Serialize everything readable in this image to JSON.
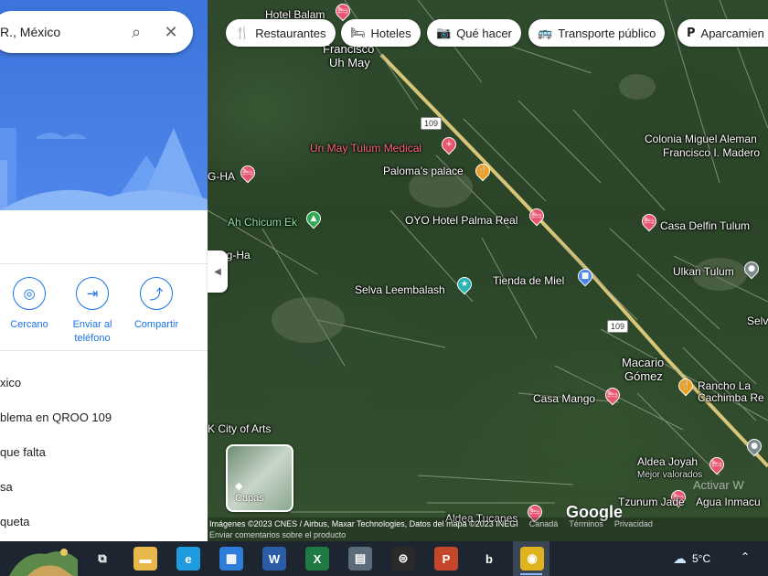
{
  "search": {
    "query": "R., México",
    "search_icon": "search-icon",
    "close_icon": "close-icon"
  },
  "chips": [
    {
      "label": "Restaurantes",
      "icon": "fork-knife-icon",
      "glyph": "🍴"
    },
    {
      "label": "Hoteles",
      "icon": "bed-icon",
      "glyph": "🛏"
    },
    {
      "label": "Qué hacer",
      "icon": "camera-icon",
      "glyph": "📷"
    },
    {
      "label": "Transporte público",
      "icon": "bus-icon",
      "glyph": "🚌"
    },
    {
      "label": "Aparcamien",
      "icon": "parking-icon",
      "glyph": "P"
    }
  ],
  "actions": [
    {
      "label": "Cercano",
      "icon": "nearby-icon",
      "glyph": "◎"
    },
    {
      "label": "Enviar al teléfono",
      "icon": "send-to-phone-icon",
      "glyph": "⇥"
    },
    {
      "label": "Compartir",
      "icon": "share-icon",
      "glyph": "⤴"
    }
  ],
  "list_items": [
    "xico",
    "blema en QROO 109",
    "que falta",
    "sa",
    "queta"
  ],
  "map": {
    "labels": [
      {
        "text": "Hotel Balam",
        "cls": ""
      },
      {
        "text": "Francisco",
        "cls": "big"
      },
      {
        "text": "Uh May",
        "cls": "big"
      },
      {
        "text": "Un May Tulum Medical",
        "cls": "pink"
      },
      {
        "text": "Paloma's palace",
        "cls": ""
      },
      {
        "text": "Colonia Miguel Aleman",
        "cls": ""
      },
      {
        "text": "Francisco I. Madero",
        "cls": ""
      },
      {
        "text": "G-HA",
        "cls": ""
      },
      {
        "text": "Ah Chicum Ek",
        "cls": "green"
      },
      {
        "text": "OYO Hotel Palma Real",
        "cls": ""
      },
      {
        "text": "Casa Delfin Tulum",
        "cls": ""
      },
      {
        "text": "ag-Ha",
        "cls": ""
      },
      {
        "text": "Ulkan Tulum",
        "cls": ""
      },
      {
        "text": "Selva Leembalash",
        "cls": ""
      },
      {
        "text": "Tienda de Miel",
        "cls": ""
      },
      {
        "text": "Selv",
        "cls": ""
      },
      {
        "text": "Macario",
        "cls": "big"
      },
      {
        "text": "Gómez",
        "cls": "big"
      },
      {
        "text": "Rancho La",
        "cls": ""
      },
      {
        "text": "Cachimba Re",
        "cls": ""
      },
      {
        "text": "Casa Mango",
        "cls": ""
      },
      {
        "text": "K City of Arts",
        "cls": ""
      },
      {
        "text": "Aldea Joyah",
        "cls": ""
      },
      {
        "text": "Mejor valorados",
        "cls": "small"
      },
      {
        "text": "Tzunum Jade",
        "cls": ""
      },
      {
        "text": "Agua Inmacu",
        "cls": ""
      },
      {
        "text": "Aldea Tucanes",
        "cls": ""
      }
    ],
    "road_shields": [
      "109",
      "109"
    ],
    "layers_label": "Capas",
    "attribution": "Imágenes ©2023 CNES / Airbus, Maxar Technologies, Datos del mapa ©2023 INEGI",
    "attribution_links": [
      "Canadá",
      "Términos",
      "Privacidad"
    ],
    "feedback": "Enviar comentarios sobre el producto",
    "logo": "Google",
    "watermark": "Activar W"
  },
  "taskbar": {
    "apps": [
      {
        "name": "task-view-icon",
        "glyph": "⧉",
        "color": "#1c2530"
      },
      {
        "name": "file-explorer-icon",
        "glyph": "▬",
        "color": "#e8b84a"
      },
      {
        "name": "edge-icon",
        "glyph": "e",
        "color": "#1f9be0"
      },
      {
        "name": "store-icon",
        "glyph": "▦",
        "color": "#2e7dd8"
      },
      {
        "name": "word-icon",
        "glyph": "W",
        "color": "#2b5ca8"
      },
      {
        "name": "excel-icon",
        "glyph": "X",
        "color": "#1f7a44"
      },
      {
        "name": "calculator-icon",
        "glyph": "▤",
        "color": "#5a6b7a"
      },
      {
        "name": "app-icon",
        "glyph": "⊜",
        "color": "#2a2a2a"
      },
      {
        "name": "powerpoint-icon",
        "glyph": "P",
        "color": "#c4462b"
      },
      {
        "name": "bing-icon",
        "glyph": "b",
        "color": "#1c2530"
      },
      {
        "name": "chrome-icon",
        "glyph": "◉",
        "color": "#e0b21e"
      }
    ],
    "weather_temp": "5°C",
    "weather_icon": "cloud-icon"
  }
}
